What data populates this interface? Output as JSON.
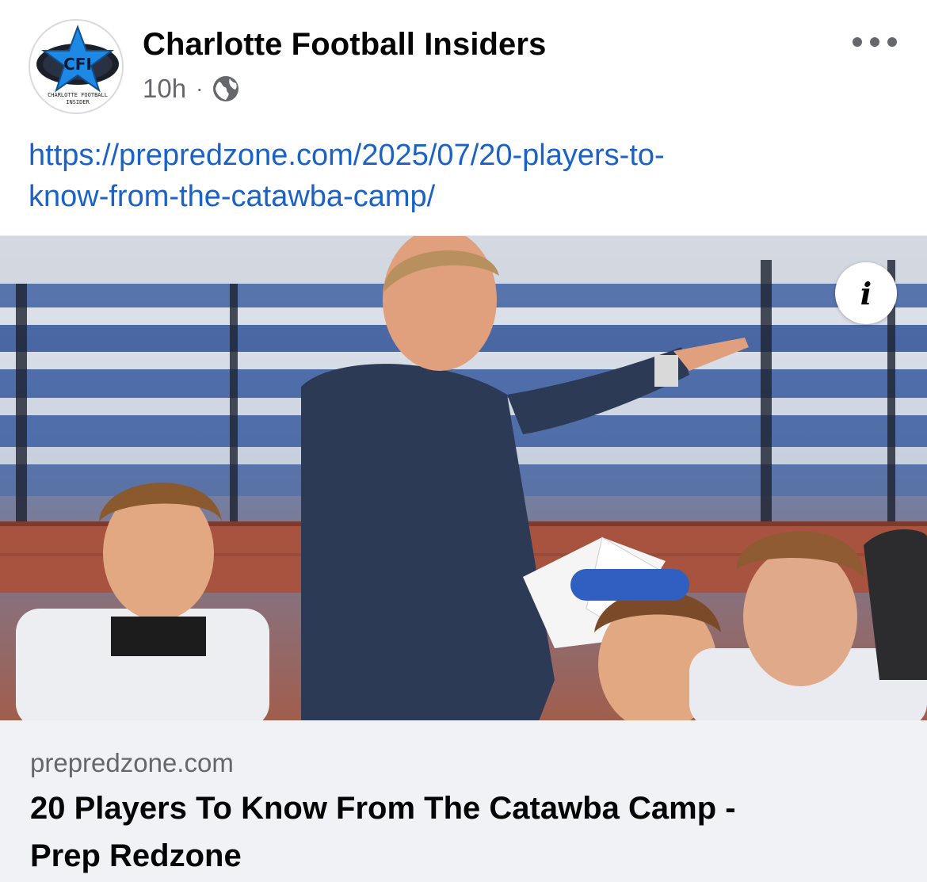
{
  "post": {
    "page_name": "Charlotte Football Insiders",
    "timestamp": "10h",
    "separator": "·",
    "privacy_icon": "globe-icon",
    "avatar": {
      "logo_text": "CFI",
      "logo_subtext_line1": "CHARLOTTE FOOTBALL",
      "logo_subtext_line2": "INSIDER"
    },
    "more_icon": "more-options-icon",
    "link_line1": "https://prepredzone.com/2025/07/20-players-to-",
    "link_line2": "know-from-the-catawba-camp/"
  },
  "link_card": {
    "info_icon_glyph": "i",
    "domain": "prepredzone.com",
    "title_line1": "20 Players To Know From The Catawba Camp -",
    "title_line2": "Prep Redzone"
  },
  "colors": {
    "link": "#1a62c6",
    "meta": "#65676b",
    "card_bg": "#f0f2f5",
    "logo_blue": "#1e88e5",
    "shirt_navy": "#2c3a55"
  }
}
